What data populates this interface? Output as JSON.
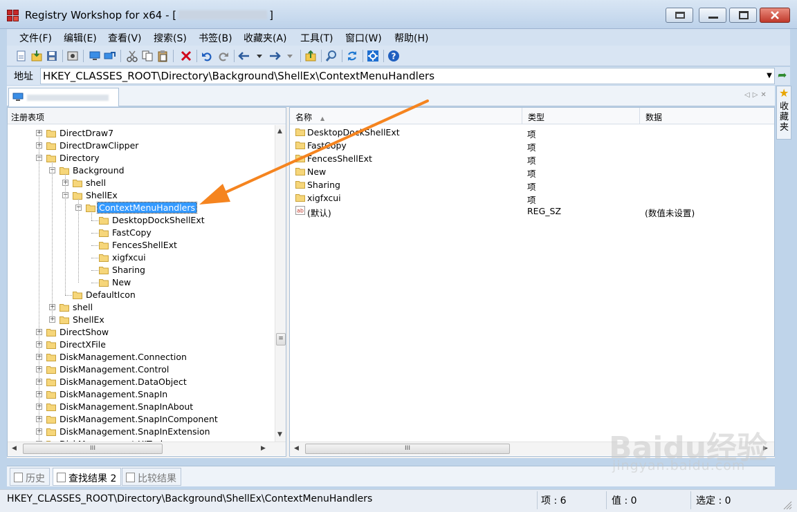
{
  "window": {
    "title_prefix": "Registry Workshop for x64 - [",
    "title_suffix": "]"
  },
  "menu": [
    "文件(F)",
    "编辑(E)",
    "查看(V)",
    "搜索(S)",
    "书签(B)",
    "收藏夹(A)",
    "工具(T)",
    "窗口(W)",
    "帮助(H)"
  ],
  "address": {
    "label": "地址",
    "value": "HKEY_CLASSES_ROOT\\Directory\\Background\\ShellEx\\ContextMenuHandlers"
  },
  "favorites_tab": "收藏夹",
  "tree": {
    "header": "注册表项",
    "items": [
      {
        "label": "DirectDraw7",
        "expander": "+"
      },
      {
        "label": "DirectDrawClipper",
        "expander": "+"
      },
      {
        "label": "Directory",
        "expander": "-"
      },
      {
        "label": "Background",
        "expander": "-"
      },
      {
        "label": "shell",
        "expander": "+"
      },
      {
        "label": "ShellEx",
        "expander": "-"
      },
      {
        "label": "ContextMenuHandlers",
        "expander": "-",
        "selected": true
      },
      {
        "label": "DesktopDockShellExt",
        "expander": ""
      },
      {
        "label": "FastCopy",
        "expander": ""
      },
      {
        "label": "FencesShellExt",
        "expander": ""
      },
      {
        "label": "xigfxcui",
        "expander": ""
      },
      {
        "label": "Sharing",
        "expander": ""
      },
      {
        "label": "New",
        "expander": ""
      },
      {
        "label": "DefaultIcon",
        "expander": ""
      },
      {
        "label": "shell",
        "expander": "+"
      },
      {
        "label": "ShellEx",
        "expander": "+"
      },
      {
        "label": "DirectShow",
        "expander": "+"
      },
      {
        "label": "DirectXFile",
        "expander": "+"
      },
      {
        "label": "DiskManagement.Connection",
        "expander": "+"
      },
      {
        "label": "DiskManagement.Control",
        "expander": "+"
      },
      {
        "label": "DiskManagement.DataObject",
        "expander": "+"
      },
      {
        "label": "DiskManagement.SnapIn",
        "expander": "+"
      },
      {
        "label": "DiskManagement.SnapInAbout",
        "expander": "+"
      },
      {
        "label": "DiskManagement.SnapInComponent",
        "expander": "+"
      },
      {
        "label": "DiskManagement.SnapInExtension",
        "expander": "+"
      },
      {
        "label": "DiskManagement.UITasks",
        "expander": "+"
      }
    ]
  },
  "list": {
    "columns": [
      "名称",
      "类型",
      "数据"
    ],
    "rows": [
      {
        "name": "DesktopDockShellExt",
        "type": "项",
        "data": "",
        "icon": "folder-icon"
      },
      {
        "name": "FastCopy",
        "type": "项",
        "data": "",
        "icon": "folder-icon"
      },
      {
        "name": "FencesShellExt",
        "type": "项",
        "data": "",
        "icon": "folder-icon"
      },
      {
        "name": "New",
        "type": "项",
        "data": "",
        "icon": "folder-icon"
      },
      {
        "name": "Sharing",
        "type": "项",
        "data": "",
        "icon": "folder-icon"
      },
      {
        "name": "xigfxcui",
        "type": "项",
        "data": "",
        "icon": "folder-icon"
      },
      {
        "name": "(默认)",
        "type": "REG_SZ",
        "data": "(数值未设置)",
        "icon": "string-value-icon"
      }
    ]
  },
  "bottom_tabs": [
    "历史",
    "查找结果 2",
    "比较结果"
  ],
  "status": {
    "path": "HKEY_CLASSES_ROOT\\Directory\\Background\\ShellEx\\ContextMenuHandlers",
    "items": "项 : 6",
    "values": "值 : 0",
    "selected": "选定 : 0"
  },
  "colors": {
    "selection": "#3399ff",
    "arrow": "#f5841f",
    "folder": "#f6d67a"
  },
  "watermark": {
    "main": "Baidu经验",
    "sub": "jingyan.baidu.com"
  }
}
